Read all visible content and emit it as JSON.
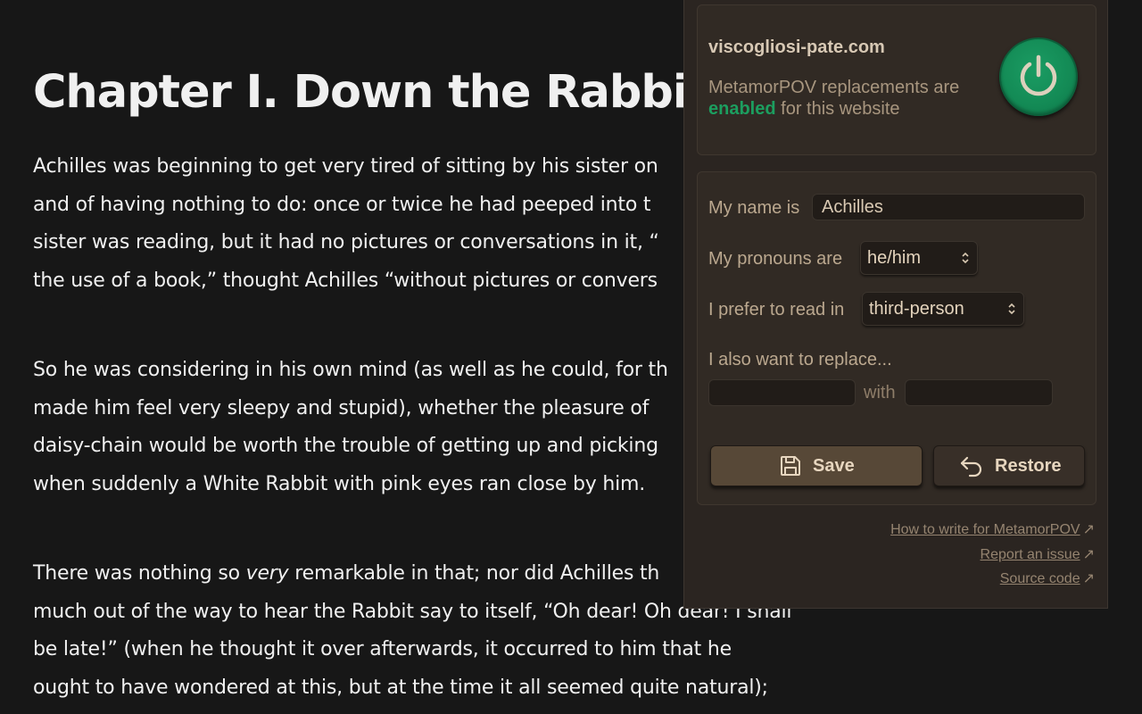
{
  "article": {
    "title": "Chapter I. Down the Rabbit-H",
    "paragraphs": [
      {
        "lines": [
          "Achilles was beginning to get very tired of sitting by his sister on",
          "and of having nothing to do: once or twice he had peeped into t",
          "sister was reading, but it had no pictures or conversations in it, “",
          "the use of a book,” thought Achilles “without pictures or convers"
        ]
      },
      {
        "lines": [
          "So he was considering in his own mind (as well as he could, for th",
          "made him feel very sleepy and stupid), whether the pleasure of",
          "daisy-chain would be worth the trouble of getting up and picking",
          "when suddenly a White Rabbit with pink eyes ran close by him."
        ]
      },
      {
        "line1_before": "There was nothing so ",
        "line1_em": "very",
        "line1_after": " remarkable in that; nor did Achilles th",
        "lines": [
          "much out of the way to hear the Rabbit say to itself, “Oh dear! Oh dear! I shall",
          "be late!” (when he thought it over afterwards, it occurred to him that he",
          "ought to have wondered at this, but at the time it all seemed quite natural);"
        ]
      }
    ]
  },
  "popup": {
    "site": "viscogliosi-pate.com",
    "status_prefix": "MetamorPOV replacements are",
    "status_value": "enabled",
    "status_suffix": " for this website",
    "power_icon": "power-icon",
    "name_label": "My name is",
    "name_value": "Achilles",
    "pronouns_label": "My pronouns are",
    "pronouns_value": "he/him",
    "pov_label": "I prefer to read in",
    "pov_value": "third-person",
    "replace_label": "I also want to replace...",
    "replace_from": "",
    "with_label": "with",
    "replace_to": "",
    "save_label": "Save",
    "restore_label": "Restore",
    "links": {
      "write": "How to write for MetamorPOV",
      "issue": "Report an issue",
      "source": "Source code"
    },
    "colors": {
      "accent_green": "#1c9e5f",
      "panel_bg": "#2b2521"
    }
  }
}
